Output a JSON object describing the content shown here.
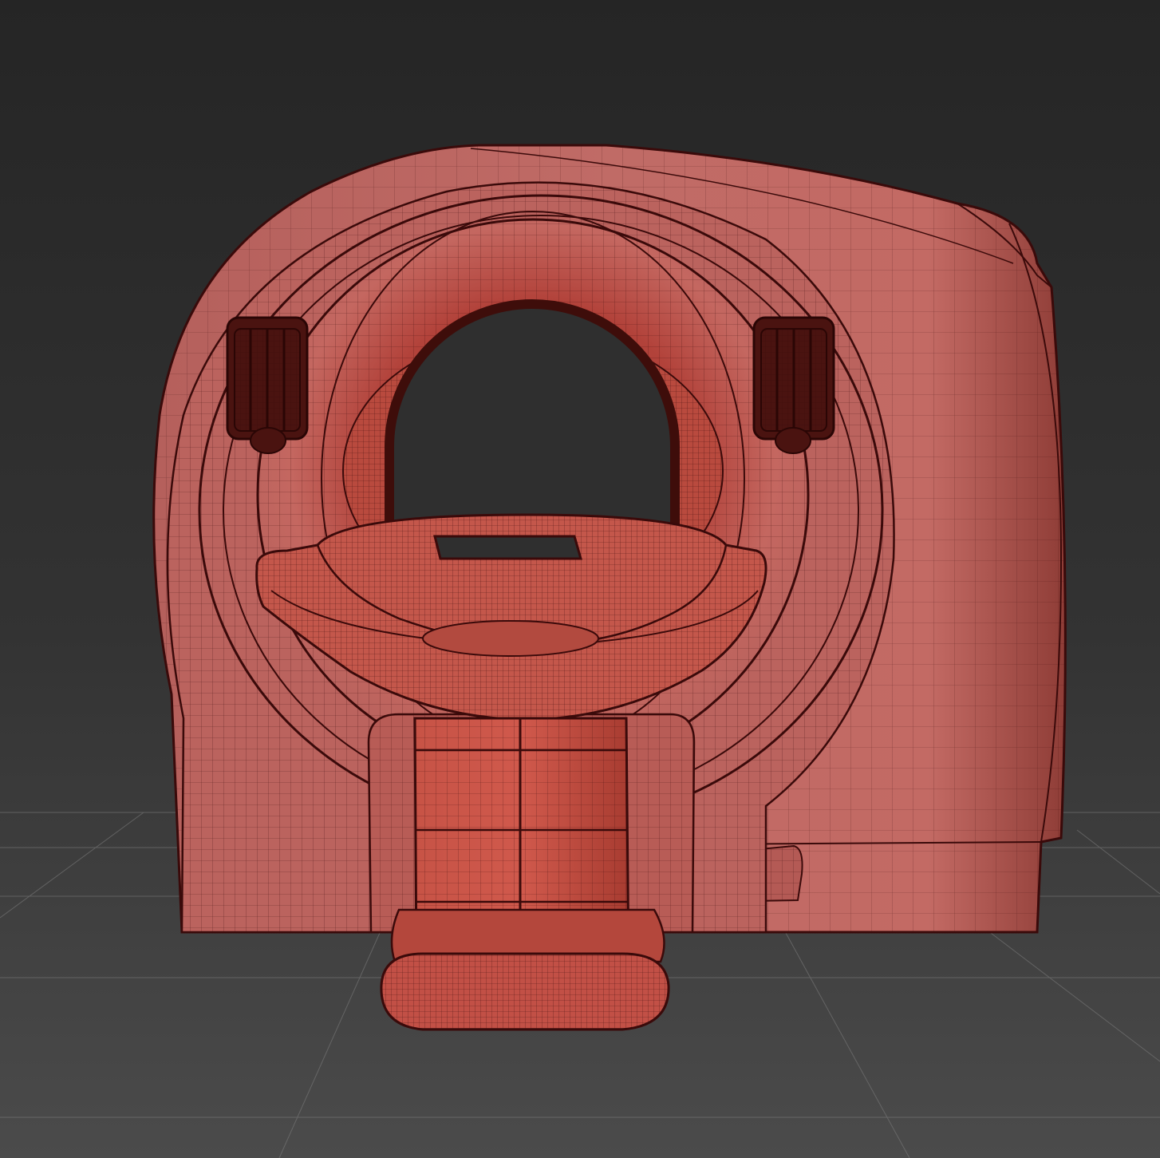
{
  "viewport": {
    "background_top": "#262626",
    "background_bottom": "#4a4a4a",
    "grid_color": "#7a7a7a",
    "wire_color": "#3a0a0a"
  },
  "model": {
    "subject": "ct-scanner",
    "shading": "wireframe-on-shaded",
    "surface_color": "#b8625f",
    "surface_highlight": "#d9837d",
    "surface_shadow": "#8a3a36",
    "inner_red": "#c0473a",
    "dark_red": "#3e0d0a"
  }
}
